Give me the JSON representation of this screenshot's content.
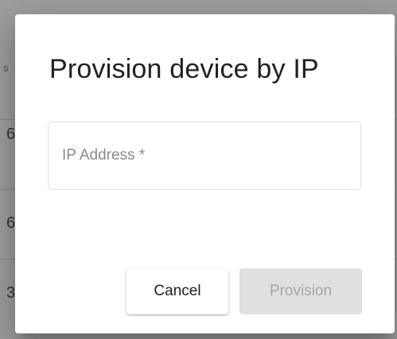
{
  "background": {
    "header_fragment": "s",
    "row_fragments": [
      "6",
      "6",
      "3"
    ]
  },
  "dialog": {
    "title": "Provision device by IP",
    "ip_field": {
      "placeholder": "IP Address *",
      "value": ""
    },
    "actions": {
      "cancel_label": "Cancel",
      "provision_label": "Provision",
      "provision_enabled": false
    }
  },
  "colors": {
    "dialog_background": "#ffffff",
    "title_text": "#212121",
    "disabled_button_bg": "#e0e0e0",
    "disabled_button_text": "#a6a6a6"
  }
}
